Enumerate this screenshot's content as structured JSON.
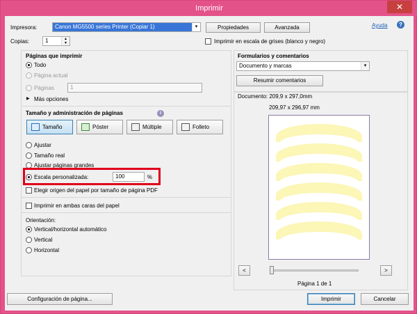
{
  "window": {
    "title": "Imprimir",
    "close_glyph": "✕"
  },
  "printer": {
    "label": "Impresora:",
    "value": "Canon MG5500 series Printer (Copiar 1)",
    "properties_label": "Propiedades",
    "advanced_label": "Avanzada",
    "help_label": "Ayuda"
  },
  "copies": {
    "label": "Copias:",
    "value": "1"
  },
  "grayscale": {
    "label": "Imprimir en escala de grises (blanco y negro)",
    "checked": false
  },
  "pages": {
    "heading": "Páginas que imprimir",
    "all_label": "Todo",
    "current_label": "Página actual",
    "pages_label": "Páginas",
    "pages_value": "1",
    "more_label": "Más opciones"
  },
  "sizing": {
    "heading": "Tamaño y administración de páginas",
    "tabs": [
      "Tamaño",
      "Póster",
      "Múltiple",
      "Folleto"
    ],
    "active_tab": "Tamaño",
    "fit_label": "Ajustar",
    "actual_label": "Tamaño real",
    "shrink_label": "Ajustar páginas grandes",
    "custom_label": "Escala personalizada:",
    "custom_value": "100",
    "percent": "%",
    "paper_source_label": "Elegir origen del papel por tamaño de página PDF"
  },
  "duplex": {
    "label": "Imprimir en ambas caras del papel"
  },
  "orientation": {
    "heading": "Orientación:",
    "options": [
      "Vertical/horizontal automático",
      "Vertical",
      "Horizontal"
    ],
    "selected": "Vertical/horizontal automático"
  },
  "forms": {
    "heading": "Formularios y comentarios",
    "value": "Documento y marcas",
    "summarize_label": "Resumir comentarios"
  },
  "preview": {
    "doc_label": "Documento: 209,9 x 297,0mm",
    "size_label": "209,97 x 296,97 mm",
    "page_label": "Página 1 de 1",
    "prev_glyph": "<",
    "next_glyph": ">"
  },
  "footer": {
    "page_setup_label": "Configuración de página...",
    "print_label": "Imprimir",
    "cancel_label": "Cancelar"
  },
  "colors": {
    "accent": "#e4528a",
    "highlight": "#e0001b",
    "selection": "#3875d7"
  }
}
